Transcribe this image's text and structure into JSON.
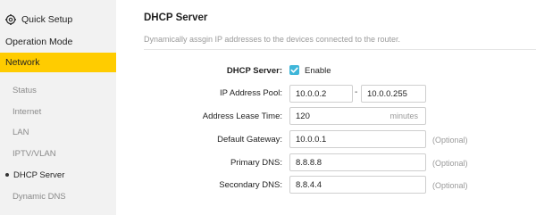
{
  "sidebar": {
    "quick_setup": "Quick Setup",
    "operation_mode": "Operation Mode",
    "network": "Network",
    "items": [
      {
        "label": "Status"
      },
      {
        "label": "Internet"
      },
      {
        "label": "LAN"
      },
      {
        "label": "IPTV/VLAN"
      },
      {
        "label": "DHCP Server"
      },
      {
        "label": "Dynamic DNS"
      }
    ],
    "active_item": "DHCP Server",
    "accent_color": "#ffcc00"
  },
  "main": {
    "title": "DHCP Server",
    "description": "Dynamically assgin IP addresses to the devices connected to the router.",
    "dhcp_server": {
      "label": "DHCP Server:",
      "checkbox_label": "Enable",
      "checked": true,
      "checkbox_color": "#3fb6d9"
    },
    "ip_pool": {
      "label": "IP Address Pool:",
      "start": "10.0.0.2",
      "separator": "-",
      "end": "10.0.0.255"
    },
    "lease_time": {
      "label": "Address Lease Time:",
      "value": "120",
      "unit": "minutes"
    },
    "default_gateway": {
      "label": "Default Gateway:",
      "value": "10.0.0.1",
      "hint": "(Optional)"
    },
    "primary_dns": {
      "label": "Primary DNS:",
      "value": "8.8.8.8",
      "hint": "(Optional)"
    },
    "secondary_dns": {
      "label": "Secondary DNS:",
      "value": "8.8.4.4",
      "hint": "(Optional)"
    }
  }
}
